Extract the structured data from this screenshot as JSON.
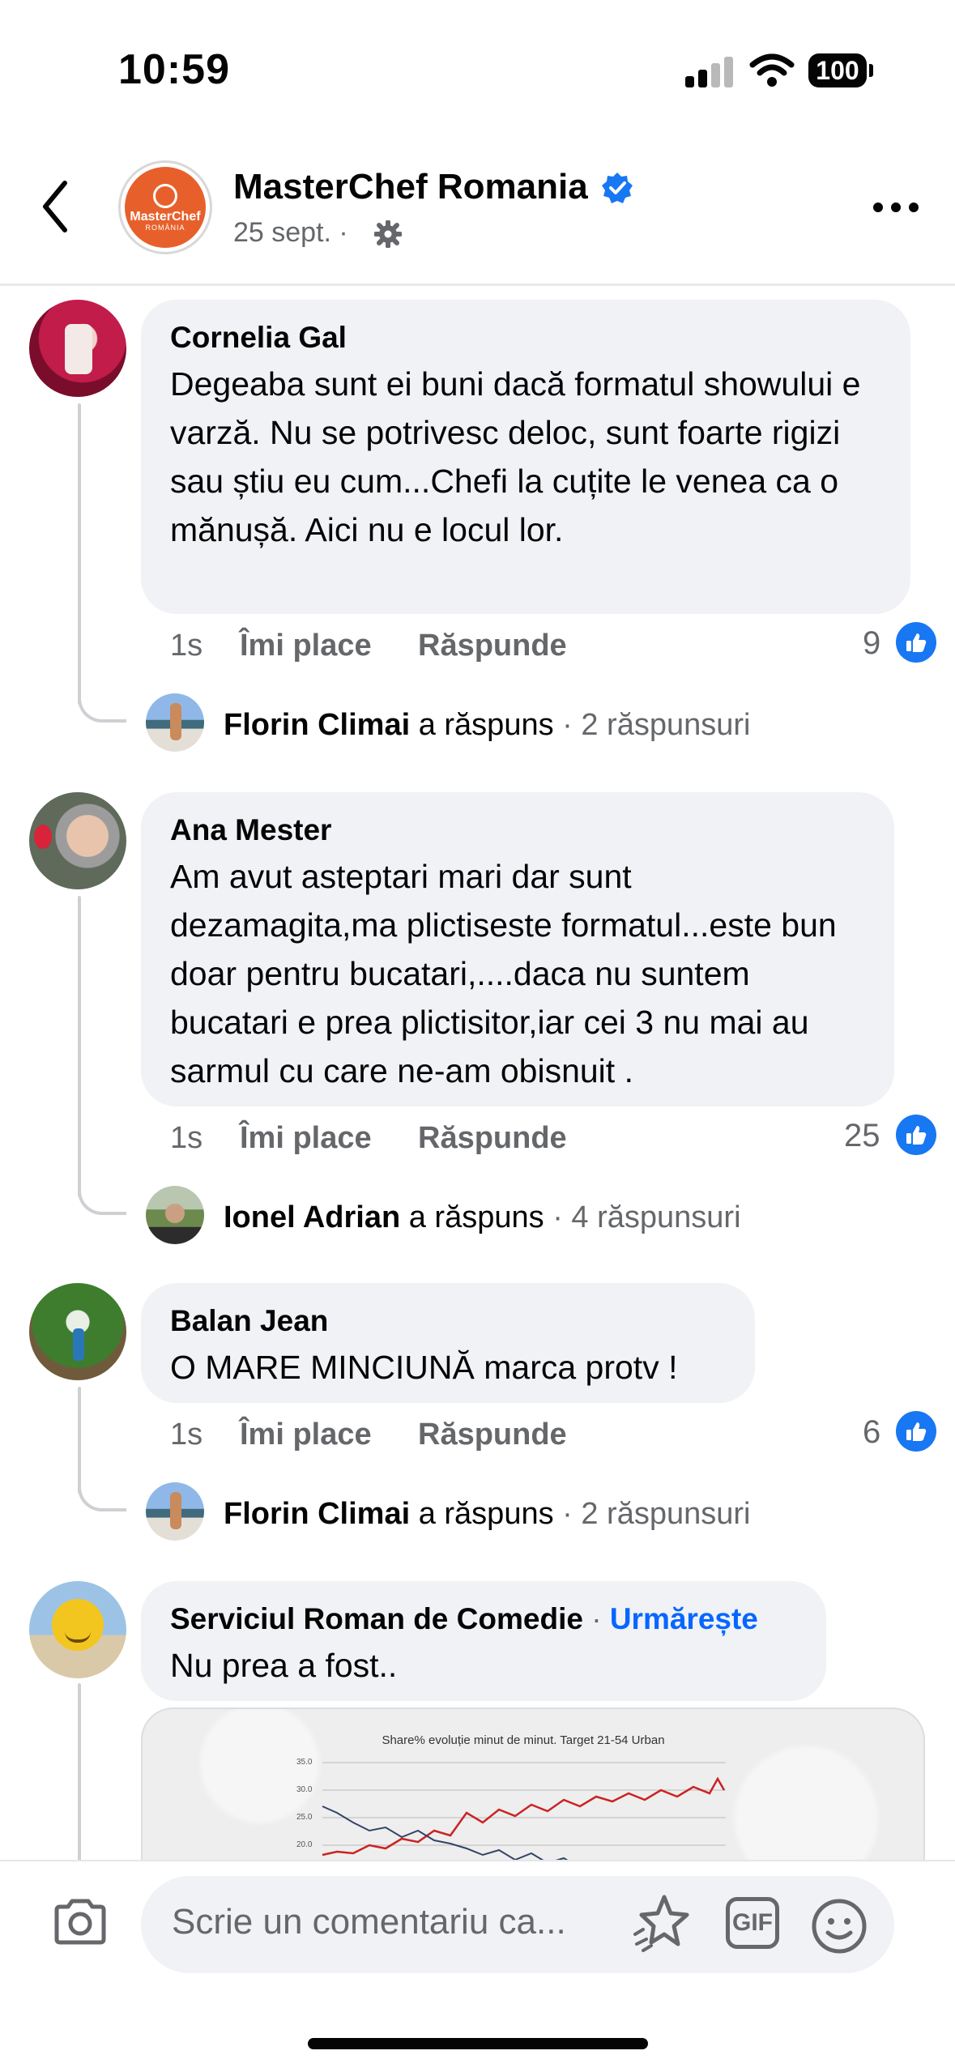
{
  "status_bar": {
    "time": "10:59",
    "battery": "100"
  },
  "header": {
    "page_name": "MasterChef Romania",
    "date": "25 sept. ·",
    "avatar_text_1": "MasterChef",
    "avatar_text_2": "ROMÂNIA"
  },
  "comments": [
    {
      "author": "Cornelia Gal",
      "text": "Degeaba sunt ei buni dacă formatul showului e varză. Nu se potrivesc deloc, sunt foarte rigizi sau știu eu cum...Chefi la cuțite le venea ca o mănușă. Aici nu e locul lor.",
      "time": "1s",
      "like_label": "Îmi place",
      "reply_label": "Răspunde",
      "likes": "9",
      "reply_name": "Florin Climai",
      "reply_verb": "a răspuns",
      "reply_count": "· 2 răspunsuri"
    },
    {
      "author": "Ana Mester",
      "text": "Am avut asteptari mari dar sunt dezamagita,ma plictiseste formatul...este bun doar pentru bucatari,....daca nu suntem bucatari e prea plictisitor,iar cei 3 nu mai au sarmul cu care ne-am obisnuit .",
      "time": "1s",
      "like_label": "Îmi place",
      "reply_label": "Răspunde",
      "likes": "25",
      "reply_name": "Ionel Adrian",
      "reply_verb": "a răspuns",
      "reply_count": "· 4 răspunsuri"
    },
    {
      "author": "Balan Jean",
      "text": "O MARE MINCIUNĂ marca protv !",
      "time": "1s",
      "like_label": "Îmi place",
      "reply_label": "Răspunde",
      "likes": "6",
      "reply_name": "Florin Climai",
      "reply_verb": "a răspuns",
      "reply_count": "· 2 răspunsuri"
    },
    {
      "author": "Serviciul Roman de Comedie",
      "follow_sep": " · ",
      "follow_label": "Urmărește",
      "text": "Nu prea a fost.."
    }
  ],
  "attachment": {
    "chart_title": "Share% evoluție minut de minut. Target 21-54 Urban",
    "y_ticks": [
      "35.0",
      "30.0",
      "25.0",
      "20.0"
    ]
  },
  "composer": {
    "placeholder": "Scrie un comentariu ca...",
    "gif_label": "GIF"
  },
  "colors": {
    "like_blue": "#1877f2",
    "follow_blue": "#0866ff",
    "bubble_gray": "#f0f2f5",
    "brand_orange": "#e7602b"
  }
}
